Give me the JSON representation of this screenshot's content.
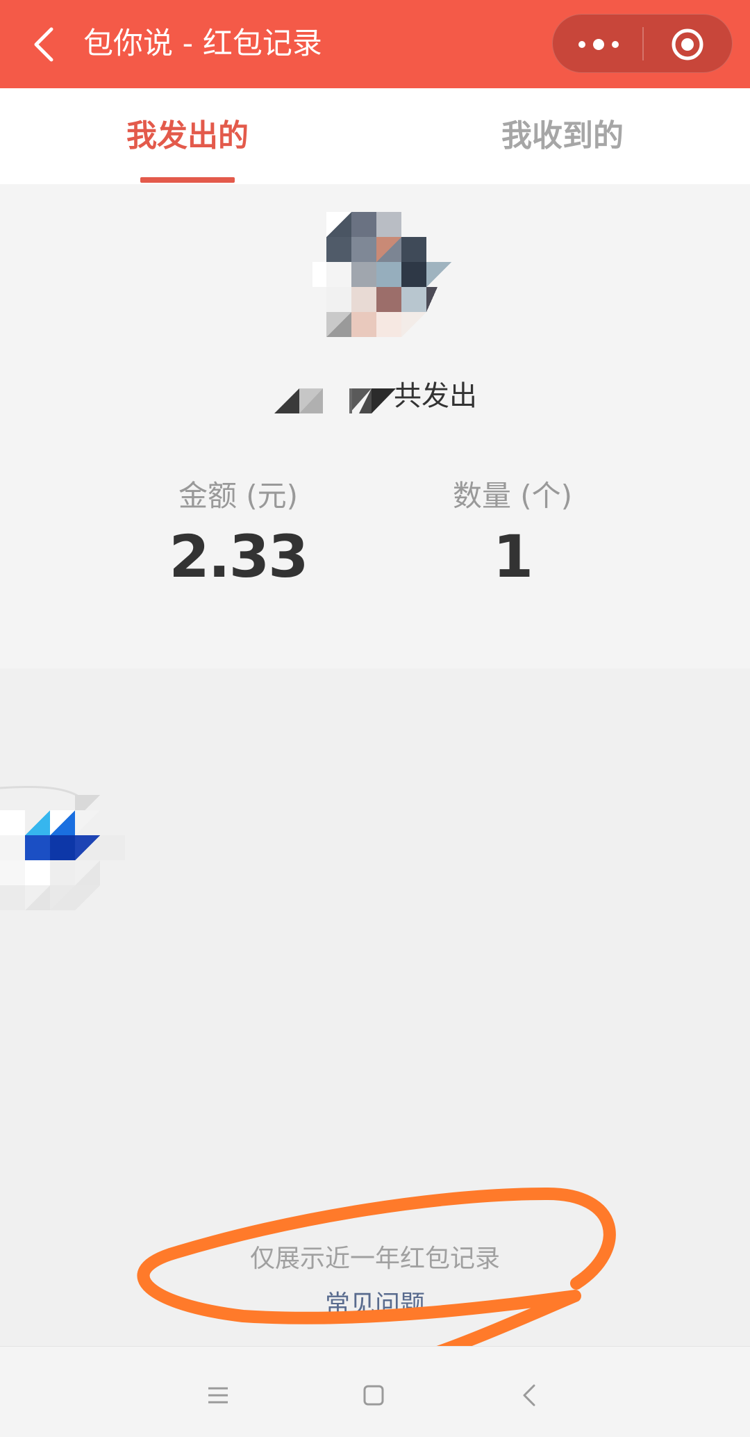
{
  "header": {
    "title": "包你说 - 红包记录",
    "back_icon": "chevron-left-icon",
    "more_icon": "more-dots-icon",
    "close_icon": "target-circle-icon",
    "background": "#f45a48"
  },
  "tabs": [
    {
      "label": "我发出的",
      "active": true
    },
    {
      "label": "我收到的",
      "active": false
    }
  ],
  "summary": {
    "caption": "共发出",
    "amount_label": "金额 (元)",
    "amount_value": "2.33",
    "count_label": "数量 (个)",
    "count_value": "1"
  },
  "footer": {
    "note": "仅展示近一年红包记录",
    "link": "常见问题"
  },
  "system_nav": {
    "menu_icon": "menu-lines-icon",
    "home_icon": "square-home-icon",
    "back_icon": "chevron-left-icon"
  },
  "colors": {
    "accent": "#e35a4b",
    "annotation": "#ff7a2a"
  }
}
